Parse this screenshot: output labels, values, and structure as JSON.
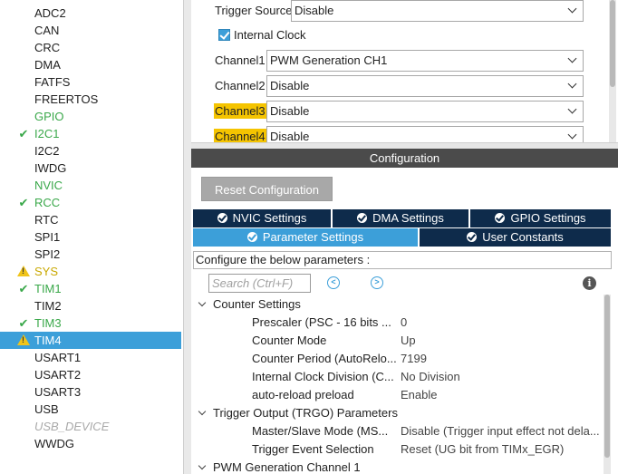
{
  "sidebar": {
    "items": [
      {
        "label": "ADC2",
        "status": "none"
      },
      {
        "label": "CAN",
        "status": "none"
      },
      {
        "label": "CRC",
        "status": "none"
      },
      {
        "label": "DMA",
        "status": "none"
      },
      {
        "label": "FATFS",
        "status": "none"
      },
      {
        "label": "FREERTOS",
        "status": "none"
      },
      {
        "label": "GPIO",
        "status": "green"
      },
      {
        "label": "I2C1",
        "status": "check"
      },
      {
        "label": "I2C2",
        "status": "none"
      },
      {
        "label": "IWDG",
        "status": "none"
      },
      {
        "label": "NVIC",
        "status": "green"
      },
      {
        "label": "RCC",
        "status": "check"
      },
      {
        "label": "RTC",
        "status": "none"
      },
      {
        "label": "SPI1",
        "status": "none"
      },
      {
        "label": "SPI2",
        "status": "none"
      },
      {
        "label": "SYS",
        "status": "warning"
      },
      {
        "label": "TIM1",
        "status": "check"
      },
      {
        "label": "TIM2",
        "status": "none"
      },
      {
        "label": "TIM3",
        "status": "check"
      },
      {
        "label": "TIM4",
        "status": "warning-selected"
      },
      {
        "label": "USART1",
        "status": "none"
      },
      {
        "label": "USART2",
        "status": "none"
      },
      {
        "label": "USART3",
        "status": "none"
      },
      {
        "label": "USB",
        "status": "none"
      },
      {
        "label": "USB_DEVICE",
        "status": "disabled"
      },
      {
        "label": "WWDG",
        "status": "none"
      }
    ]
  },
  "mode": {
    "trigger_source": {
      "label": "Trigger Source",
      "value": "Disable"
    },
    "internal_clock": {
      "label": "Internal Clock",
      "checked": true
    },
    "channel1": {
      "label": "Channel1",
      "value": "PWM Generation CH1"
    },
    "channel2": {
      "label": "Channel2",
      "value": "Disable"
    },
    "channel3": {
      "label": "Channel3",
      "value": "Disable"
    },
    "channel4": {
      "label": "Channel4",
      "value": "Disable"
    }
  },
  "config": {
    "header": "Configuration",
    "reset_label": "Reset Configuration",
    "tabs_row1": [
      "NVIC Settings",
      "DMA Settings",
      "GPIO Settings"
    ],
    "tabs_row2": [
      "Parameter Settings",
      "User Constants"
    ],
    "hint": "Configure the below parameters :",
    "search_placeholder": "Search (Ctrl+F)",
    "groups": [
      {
        "title": "Counter Settings",
        "params": [
          {
            "name": "Prescaler (PSC - 16 bits ...",
            "value": "0"
          },
          {
            "name": "Counter Mode",
            "value": "Up"
          },
          {
            "name": "Counter Period (AutoRelo...",
            "value": "7199"
          },
          {
            "name": "Internal Clock Division (C...",
            "value": "No Division"
          },
          {
            "name": "auto-reload preload",
            "value": "Enable"
          }
        ]
      },
      {
        "title": "Trigger Output (TRGO) Parameters",
        "params": [
          {
            "name": "Master/Slave Mode (MS...",
            "value": "Disable (Trigger input effect not dela..."
          },
          {
            "name": "Trigger Event Selection",
            "value": "Reset (UG bit from TIMx_EGR)"
          }
        ]
      },
      {
        "title": "PWM Generation Channel 1",
        "params": []
      }
    ]
  },
  "colors": {
    "accent": "#3c9fd9",
    "tab_dark": "#0e2b4b",
    "ok_green": "#3aa84a",
    "highlight": "#f5c400",
    "header_bg": "#4b4b4b"
  }
}
